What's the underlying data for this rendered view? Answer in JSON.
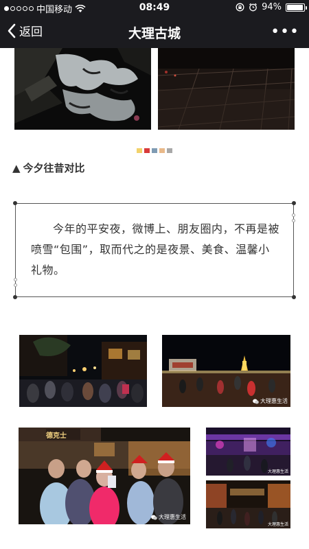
{
  "status_bar": {
    "carrier": "中国移动",
    "time": "08:49",
    "battery_percent": "94%",
    "battery_level": 0.94,
    "signal_bars": 1
  },
  "nav": {
    "back_label": "返回",
    "title": "大理古城",
    "more_label": "•••"
  },
  "carousel": {
    "dot_colors": [
      "#f2d26b",
      "#d83b3b",
      "#7f9bb3",
      "#e9b98a",
      "#a8a8a8"
    ]
  },
  "section": {
    "marker": "▲",
    "title": "今夕往昔对比"
  },
  "quote": {
    "text": "今年的平安夜，微博上、朋友圈内，不再是被喷雪“包围”，取而代之的是夜景、美食、温馨小礼物。"
  },
  "photos": {
    "shop_sign": "德克士",
    "watermark": "大理惠生活"
  },
  "colors": {
    "bar_bg": "#1b1b1f",
    "text": "#333333"
  }
}
